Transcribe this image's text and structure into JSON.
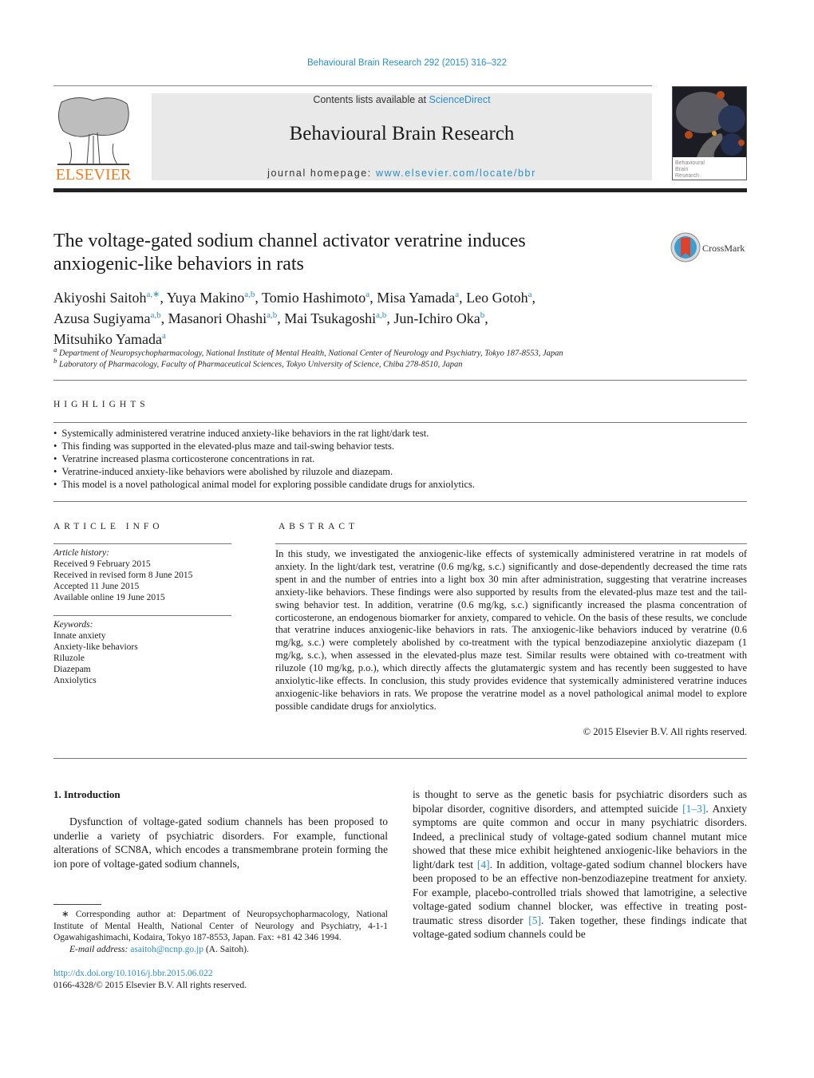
{
  "header": {
    "citation": "Behavioural Brain Research 292 (2015) 316–322",
    "contents_prefix": "Contents lists available at ",
    "contents_link": "ScienceDirect",
    "journal_title": "Behavioural Brain Research",
    "homepage_prefix": "journal homepage: ",
    "homepage_link": "www.elsevier.com/locate/bbr",
    "publisher_logo_text": "ELSEVIER",
    "cover_text": "Behavioural Brain Research",
    "publisher_color": "#f07c1f",
    "link_color": "#2a8fc4"
  },
  "article": {
    "title_line1": "The voltage-gated sodium channel activator veratrine induces",
    "title_line2": "anxiogenic-like behaviors in rats",
    "crossmark_label": "CrossMark",
    "authors": [
      {
        "name": "Akiyoshi Saitoh",
        "sup": "a,∗",
        "sep": ", "
      },
      {
        "name": "Yuya Makino",
        "sup": "a,b",
        "sep": ", "
      },
      {
        "name": "Tomio Hashimoto",
        "sup": "a",
        "sep": ", "
      },
      {
        "name": "Misa Yamada",
        "sup": "a",
        "sep": ", "
      },
      {
        "name": "Leo Gotoh",
        "sup": "a",
        "sep": ","
      },
      {
        "name": "Azusa Sugiyama",
        "sup": "a,b",
        "sep": ", "
      },
      {
        "name": "Masanori Ohashi",
        "sup": "a,b",
        "sep": ", "
      },
      {
        "name": "Mai Tsukagoshi",
        "sup": "a,b",
        "sep": ", "
      },
      {
        "name": "Jun-Ichiro Oka",
        "sup": "b",
        "sep": ","
      },
      {
        "name": "Mitsuhiko Yamada",
        "sup": "a",
        "sep": ""
      }
    ],
    "affiliations": [
      {
        "mark": "a",
        "text": "Department of Neuropsychopharmacology, National Institute of Mental Health, National Center of Neurology and Psychiatry, Tokyo 187-8553, Japan"
      },
      {
        "mark": "b",
        "text": "Laboratory of Pharmacology, Faculty of Pharmaceutical Sciences, Tokyo University of Science, Chiba 278-8510, Japan"
      }
    ]
  },
  "highlights": {
    "heading": "HIGHLIGHTS",
    "items": [
      "Systemically administered veratrine induced anxiety-like behaviors in the rat light/dark test.",
      "This finding was supported in the elevated-plus maze and tail-swing behavior tests.",
      "Veratrine increased plasma corticosterone concentrations in rat.",
      "Veratrine-induced anxiety-like behaviors were abolished by riluzole and diazepam.",
      "This model is a novel pathological animal model for exploring possible candidate drugs for anxiolytics."
    ]
  },
  "article_info": {
    "heading": "ARTICLE INFO",
    "history_label": "Article history:",
    "history": [
      "Received 9 February 2015",
      "Received in revised form 8 June 2015",
      "Accepted 11 June 2015",
      "Available online 19 June 2015"
    ],
    "keywords_label": "Keywords:",
    "keywords": [
      "Innate anxiety",
      "Anxiety-like behaviors",
      "Riluzole",
      "Diazepam",
      "Anxiolytics"
    ]
  },
  "abstract": {
    "heading": "ABSTRACT",
    "text": "In this study, we investigated the anxiogenic-like effects of systemically administered veratrine in rat models of anxiety. In the light/dark test, veratrine (0.6 mg/kg, s.c.) significantly and dose-dependently decreased the time rats spent in and the number of entries into a light box 30 min after administration, suggesting that veratrine increases anxiety-like behaviors. These findings were also supported by results from the elevated-plus maze test and the tail-swing behavior test. In addition, veratrine (0.6 mg/kg, s.c.) significantly increased the plasma concentration of corticosterone, an endogenous biomarker for anxiety, compared to vehicle. On the basis of these results, we conclude that veratrine induces anxiogenic-like behaviors in rats. The anxiogenic-like behaviors induced by veratrine (0.6 mg/kg, s.c.) were completely abolished by co-treatment with the typical benzodiazepine anxiolytic diazepam (1 mg/kg, s.c.), when assessed in the elevated-plus maze test. Similar results were obtained with co-treatment with riluzole (10 mg/kg, p.o.), which directly affects the glutamatergic system and has recently been suggested to have anxiolytic-like effects. In conclusion, this study provides evidence that systemically administered veratrine induces anxiogenic-like behaviors in rats. We propose the veratrine model as a novel pathological animal model to explore possible candidate drugs for anxiolytics.",
    "copyright": "© 2015 Elsevier B.V. All rights reserved."
  },
  "introduction": {
    "heading": "1.  Introduction",
    "left_text": "Dysfunction of voltage-gated sodium channels has been proposed to underlie a variety of psychiatric disorders. For example, functional alterations of SCN8A, which encodes a transmembrane protein forming the ion pore of voltage-gated sodium channels,",
    "right_parts": [
      {
        "t": "is thought to serve as the genetic basis for psychiatric disorders such as bipolar disorder, cognitive disorders, and attempted suicide "
      },
      {
        "ref": "[1–3]"
      },
      {
        "t": ". Anxiety symptoms are quite common and occur in many psychiatric disorders. Indeed, a preclinical study of voltage-gated sodium channel mutant mice showed that these mice exhibit heightened anxiogenic-like behaviors in the light/dark test "
      },
      {
        "ref": "[4]"
      },
      {
        "t": ". In addition, voltage-gated sodium channel blockers have been proposed to be an effective non-benzodiazepine treatment for anxiety. For example, placebo-controlled trials showed that lamotrigine, a selective voltage-gated sodium channel blocker, was effective in treating post-traumatic stress disorder "
      },
      {
        "ref": "[5]"
      },
      {
        "t": ". Taken together, these findings indicate that voltage-gated sodium channels could be"
      }
    ]
  },
  "footnote": {
    "corresponding": "∗  Corresponding author at: Department of Neuropsychopharmacology, National Institute of Mental Health, National Center of Neurology and Psychiatry, 4-1-1 Ogawahigashimachi, Kodaira, Tokyo 187-8553, Japan. Fax: +81 42 346 1994.",
    "email_label": "E-mail address:",
    "email": "asaitoh@ncnp.go.jp",
    "email_suffix": " (A. Saitoh).",
    "doi": "http://dx.doi.org/10.1016/j.bbr.2015.06.022",
    "issn": "0166-4328/© 2015 Elsevier B.V. All rights reserved."
  }
}
